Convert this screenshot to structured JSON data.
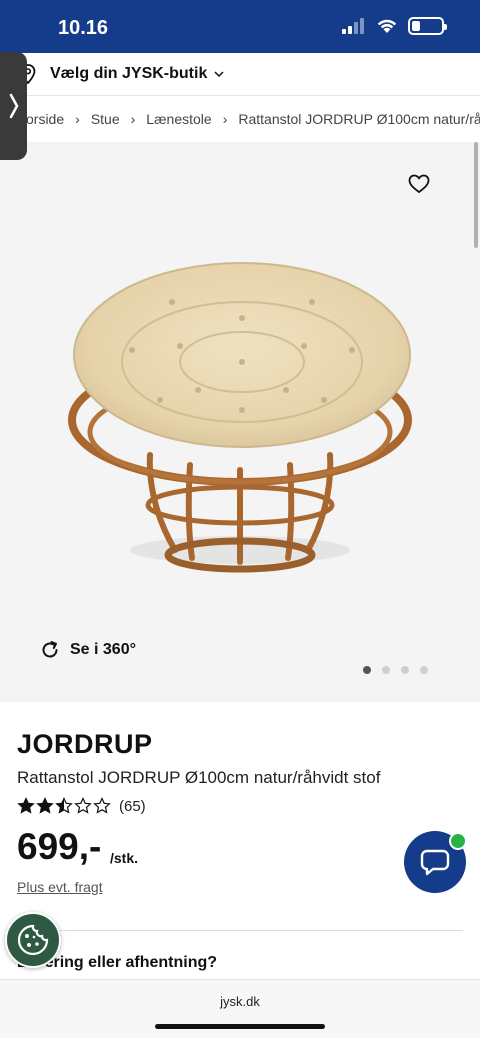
{
  "status_bar": {
    "time": "10.16",
    "battery_level": 0.3
  },
  "store": {
    "label": "Vælg din JYSK-butik"
  },
  "breadcrumb": [
    "orside",
    "Stue",
    "Lænestole",
    "Rattanstol JORDRUP Ø100cm natur/rå"
  ],
  "gallery": {
    "view360_label": "Se i 360°",
    "slide_count": 4,
    "active_slide": 1
  },
  "product": {
    "brand": "JORDRUP",
    "subtitle": "Rattanstol JORDRUP Ø100cm natur/råhvidt stof",
    "rating": 2.5,
    "review_count": "(65)",
    "price": "699,-",
    "price_unit": "/stk.",
    "freight_link": "Plus evt. fragt"
  },
  "delivery": {
    "heading": "Levering eller afhentning?"
  },
  "browser": {
    "url": "jysk.dk"
  },
  "colors": {
    "brand_blue": "#143c8a",
    "online_green": "#29b344",
    "cookie_green": "#2e5a44"
  },
  "icons": [
    "location-pin-icon",
    "chevron-down-icon",
    "chevron-right-icon",
    "heart-icon",
    "rotate-360-icon",
    "star-icon",
    "chat-bubble-icon",
    "cookie-icon"
  ]
}
